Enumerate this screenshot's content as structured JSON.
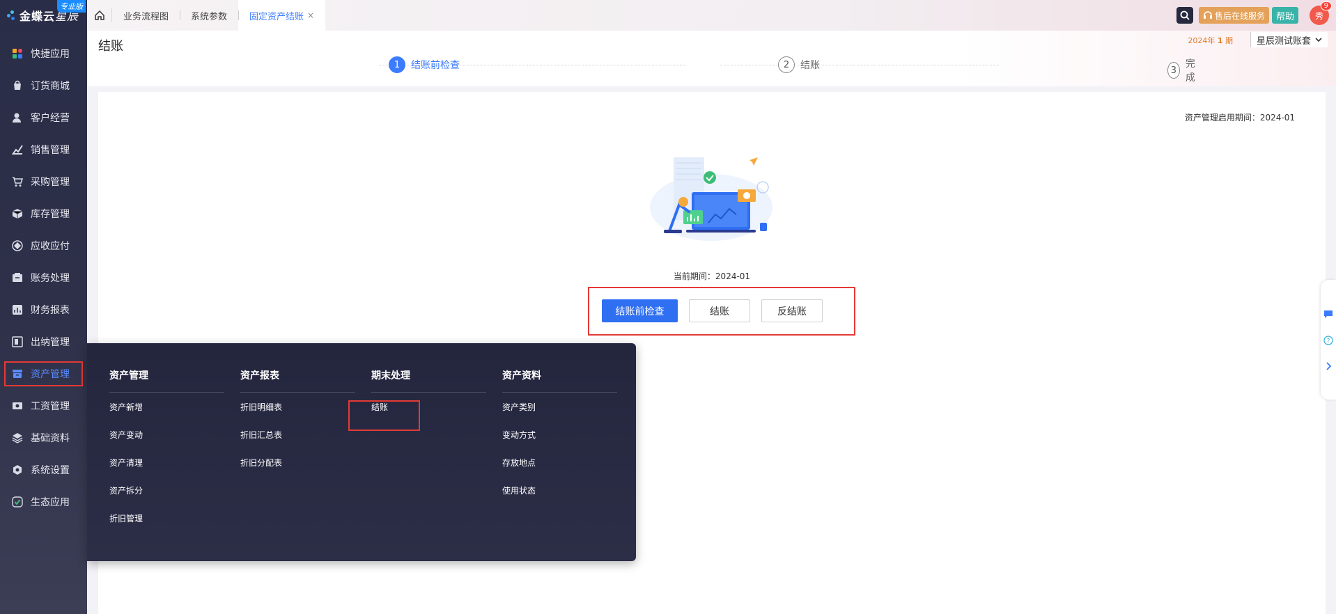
{
  "logo": {
    "brand": "金蝶云",
    "product": "星辰",
    "edition": "专业版"
  },
  "sidebar": {
    "items": [
      {
        "label": "快捷应用",
        "icon": "apps-icon"
      },
      {
        "label": "订货商城",
        "icon": "shop-bag-icon"
      },
      {
        "label": "客户经营",
        "icon": "customer-icon"
      },
      {
        "label": "销售管理",
        "icon": "sales-chart-icon"
      },
      {
        "label": "采购管理",
        "icon": "cart-icon"
      },
      {
        "label": "库存管理",
        "icon": "box-icon"
      },
      {
        "label": "应收应付",
        "icon": "diamond-icon"
      },
      {
        "label": "账务处理",
        "icon": "ledger-icon"
      },
      {
        "label": "财务报表",
        "icon": "report-icon"
      },
      {
        "label": "出纳管理",
        "icon": "cashier-icon"
      },
      {
        "label": "资产管理",
        "icon": "asset-icon"
      },
      {
        "label": "工资管理",
        "icon": "salary-icon"
      },
      {
        "label": "基础资料",
        "icon": "layers-icon"
      },
      {
        "label": "系统设置",
        "icon": "settings-icon"
      },
      {
        "label": "生态应用",
        "icon": "ecosystem-icon"
      }
    ],
    "active_index": 10
  },
  "topbar": {
    "tabs": [
      {
        "label": "业务流程图"
      },
      {
        "label": "系统参数"
      },
      {
        "label": "固定资产结账",
        "close": "×"
      }
    ],
    "service_label": "售后在线服务",
    "help_label": "帮助",
    "avatar_text": "秀",
    "notification_count": "9"
  },
  "header": {
    "title": "结账",
    "period_year": "2024年",
    "period_num": "1",
    "period_suffix": "期",
    "book_name": "星辰测试账套",
    "steps": [
      {
        "num": "1",
        "label": "结账前检查"
      },
      {
        "num": "2",
        "label": "结账"
      },
      {
        "num": "3",
        "label": "完成"
      }
    ]
  },
  "content": {
    "enable_period": "资产管理启用期间：2024-01",
    "current_period": "当前期间：2024-01",
    "buttons": {
      "precheck": "结账前检查",
      "close": "结账",
      "reverse": "反结账"
    }
  },
  "mega_menu": {
    "columns": [
      {
        "title": "资产管理",
        "items": [
          "资产新增",
          "资产变动",
          "资产清理",
          "资产拆分",
          "折旧管理"
        ]
      },
      {
        "title": "资产报表",
        "items": [
          "折旧明细表",
          "折旧汇总表",
          "折旧分配表"
        ]
      },
      {
        "title": "期末处理",
        "items": [
          "结账"
        ]
      },
      {
        "title": "资产资料",
        "items": [
          "资产类别",
          "变动方式",
          "存放地点",
          "使用状态"
        ]
      }
    ]
  },
  "colors": {
    "primary": "#2f6ff2",
    "highlight_frame": "#e53935",
    "sidebar_bg": "#2e3049"
  }
}
